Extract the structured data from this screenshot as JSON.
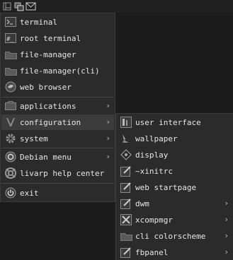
{
  "main_menu": {
    "items": [
      {
        "label": "terminal",
        "icon": "terminal-icon"
      },
      {
        "label": "root terminal",
        "icon": "root-terminal-icon"
      },
      {
        "label": "file-manager",
        "icon": "folder-icon"
      },
      {
        "label": "file-manager(cli)",
        "icon": "folder-icon"
      },
      {
        "label": "web browser",
        "icon": "web-browser-icon"
      },
      {
        "label": "applications",
        "icon": "applications-icon",
        "submenu": true
      },
      {
        "label": "configuration",
        "icon": "configuration-icon",
        "submenu": true,
        "highlighted": true
      },
      {
        "label": "system",
        "icon": "gear-icon",
        "submenu": true
      },
      {
        "label": "Debian menu",
        "icon": "debian-icon",
        "submenu": true
      },
      {
        "label": "livarp help center",
        "icon": "help-icon"
      },
      {
        "label": "exit",
        "icon": "power-icon"
      }
    ]
  },
  "config_submenu": {
    "items": [
      {
        "label": "user interface",
        "icon": "user-interface-icon"
      },
      {
        "label": "wallpaper",
        "icon": "wallpaper-icon"
      },
      {
        "label": "display",
        "icon": "display-icon"
      },
      {
        "label": "~xinitrc",
        "icon": "text-editor-icon"
      },
      {
        "label": "web startpage",
        "icon": "text-editor-icon"
      },
      {
        "label": "dwm",
        "icon": "text-editor-icon",
        "submenu": true
      },
      {
        "label": "xcompmgr",
        "icon": "tools-icon",
        "submenu": true
      },
      {
        "label": "cli colorscheme",
        "icon": "folder-icon",
        "submenu": true
      },
      {
        "label": "fbpanel",
        "icon": "text-editor-icon",
        "submenu": true
      }
    ]
  },
  "arrow_glyph": "›"
}
